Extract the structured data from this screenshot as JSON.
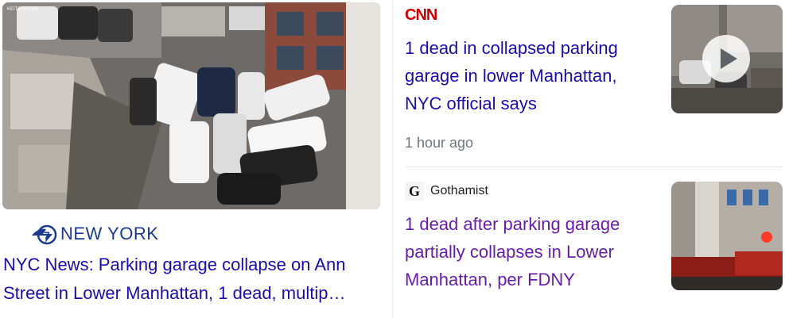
{
  "main_story": {
    "image_caption_text": "KEITH ROGIN",
    "source": "NEW YORK",
    "headline_line1": "NYC News: Parking garage collapse on Ann",
    "headline_line2": "Street in Lower Manhattan, 1 dead, multip…"
  },
  "story_1": {
    "source": "CNN",
    "headline": "1 dead in collapsed parking garage in lower Manhattan, NYC official says",
    "timestamp": "1 hour ago",
    "has_video": true,
    "play_icon": "play-icon"
  },
  "story_2": {
    "source_icon_letter": "G",
    "source": "Gothamist",
    "headline": "1 dead after parking garage partially collapses in Lower Manhattan, per FDNY"
  },
  "colors": {
    "link_unvisited": "#1a0dab",
    "link_visited": "#681da8",
    "cnn_red": "#cc0000",
    "abc_blue": "#1a3a8c",
    "meta_gray": "#70757a"
  }
}
